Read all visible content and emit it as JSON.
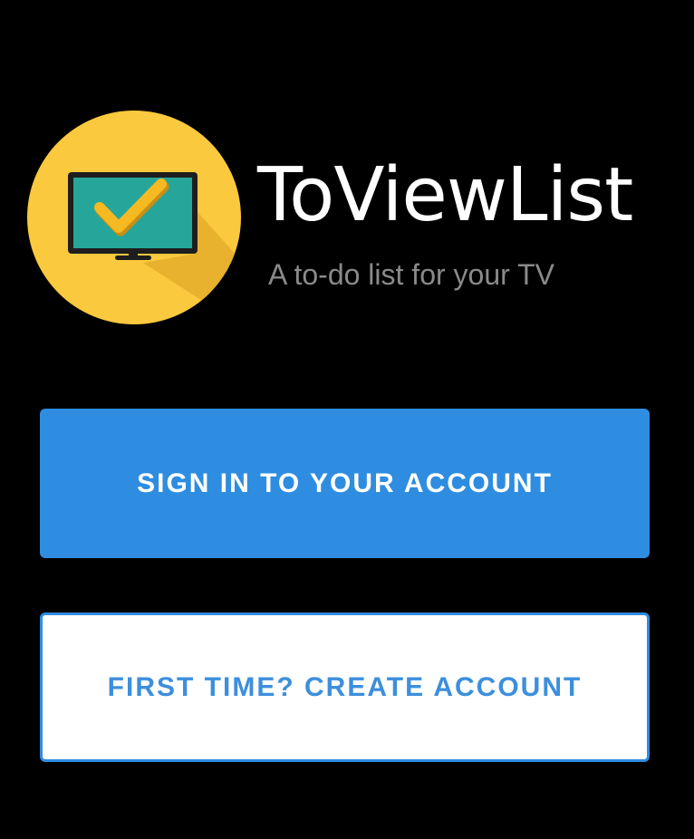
{
  "app": {
    "title": "ToViewList",
    "tagline": "A to-do list for your TV"
  },
  "buttons": {
    "sign_in_label": "SIGN IN TO YOUR ACCOUNT",
    "create_account_label": "FIRST TIME? CREATE ACCOUNT"
  },
  "logo": {
    "icon": "tv-checkmark-icon",
    "circle_color": "#fbc93d",
    "screen_color": "#26a69a",
    "check_color": "#f2b41f"
  },
  "colors": {
    "background": "#000000",
    "primary_button": "#2e8de0",
    "secondary_button_text": "#3d8fdd",
    "tagline": "#8a8a8a"
  }
}
